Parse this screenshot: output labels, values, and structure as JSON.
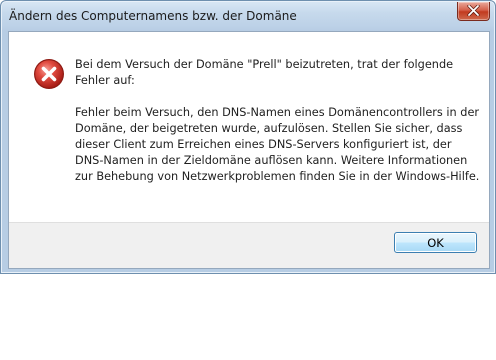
{
  "window": {
    "title": "Ändern des Computernamens bzw. der Domäne"
  },
  "dialog": {
    "icon": "error-icon",
    "message_line1": "Bei dem Versuch der Domäne \"Prell\" beizutreten, trat der folgende Fehler auf:",
    "message_line2": "Fehler beim Versuch, den DNS-Namen eines Domänencontrollers in der Domäne, der beigetreten wurde, aufzulösen. Stellen Sie sicher, dass dieser Client zum Erreichen eines DNS-Servers konfiguriert ist, der DNS-Namen in der Zieldomäne auflösen kann. Weitere Informationen zur Behebung von Netzwerkproblemen finden Sie in der Windows-Hilfe.",
    "ok_label": "OK"
  },
  "colors": {
    "error_red": "#d9342b",
    "titlebar": "#c6d9ec",
    "button_border": "#3c7fb1"
  }
}
